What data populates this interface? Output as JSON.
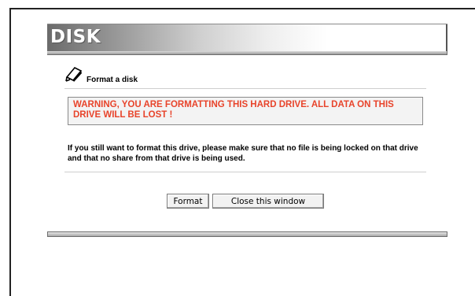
{
  "banner": {
    "title": "DISK"
  },
  "section": {
    "title": "Format a disk",
    "icon": "pen-icon"
  },
  "warning": {
    "text": "WARNING, YOU ARE FORMATTING THIS HARD DRIVE. ALL DATA ON THIS DRIVE WILL BE LOST !",
    "color": "#e8442b"
  },
  "note": {
    "text": "If you still want to format this drive, please make sure that no file is being locked on that drive and that no share from that drive is being used."
  },
  "buttons": {
    "format_label": "Format",
    "close_label": "Close this window"
  }
}
